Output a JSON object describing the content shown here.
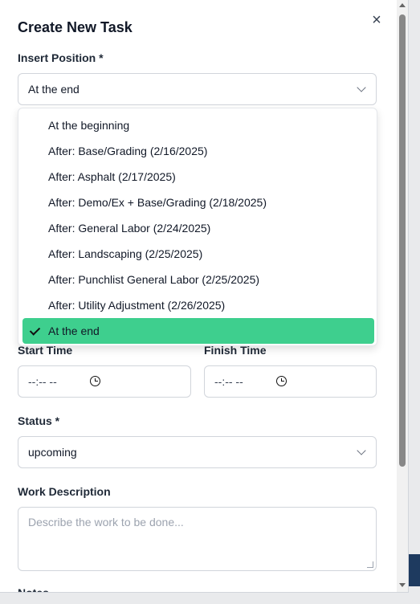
{
  "dialog": {
    "title": "Create New Task",
    "close_symbol": "×"
  },
  "insert_position": {
    "label": "Insert Position *",
    "value": "At the end",
    "options": [
      "At the beginning",
      "After: Base/Grading (2/16/2025)",
      "After: Asphalt (2/17/2025)",
      "After: Demo/Ex + Base/Grading (2/18/2025)",
      "After: General Labor (2/24/2025)",
      "After: Landscaping (2/25/2025)",
      "After: Punchlist General Labor (2/25/2025)",
      "After: Utility Adjustment (2/26/2025)",
      "At the end"
    ],
    "selected_index": 8
  },
  "start_time": {
    "label": "Start Time",
    "value": "--:-- --"
  },
  "finish_time": {
    "label": "Finish Time",
    "value": "--:-- --"
  },
  "status": {
    "label": "Status *",
    "value": "upcoming"
  },
  "work_description": {
    "label": "Work Description",
    "placeholder": "Describe the work to be done..."
  },
  "notes": {
    "label": "Notes"
  },
  "colors": {
    "selected_option": "#3ecf8e",
    "border": "#d1d5db"
  }
}
